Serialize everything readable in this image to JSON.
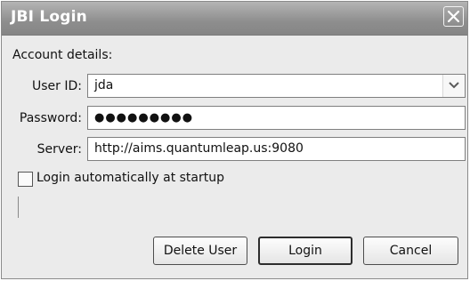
{
  "window": {
    "title": "JBI Login"
  },
  "form": {
    "section_label": "Account details:",
    "user_id": {
      "label": "User ID:",
      "value": "jda"
    },
    "password": {
      "label": "Password:",
      "value": "●●●●●●●●●"
    },
    "server": {
      "label": "Server:",
      "value": "http://aims.quantumleap.us:9080"
    },
    "auto_login": {
      "label": "Login automatically at startup",
      "checked": false
    }
  },
  "buttons": {
    "delete_user": "Delete User",
    "login": "Login",
    "cancel": "Cancel"
  },
  "icons": {
    "close": "close-icon",
    "dropdown": "chevron-down-icon"
  }
}
